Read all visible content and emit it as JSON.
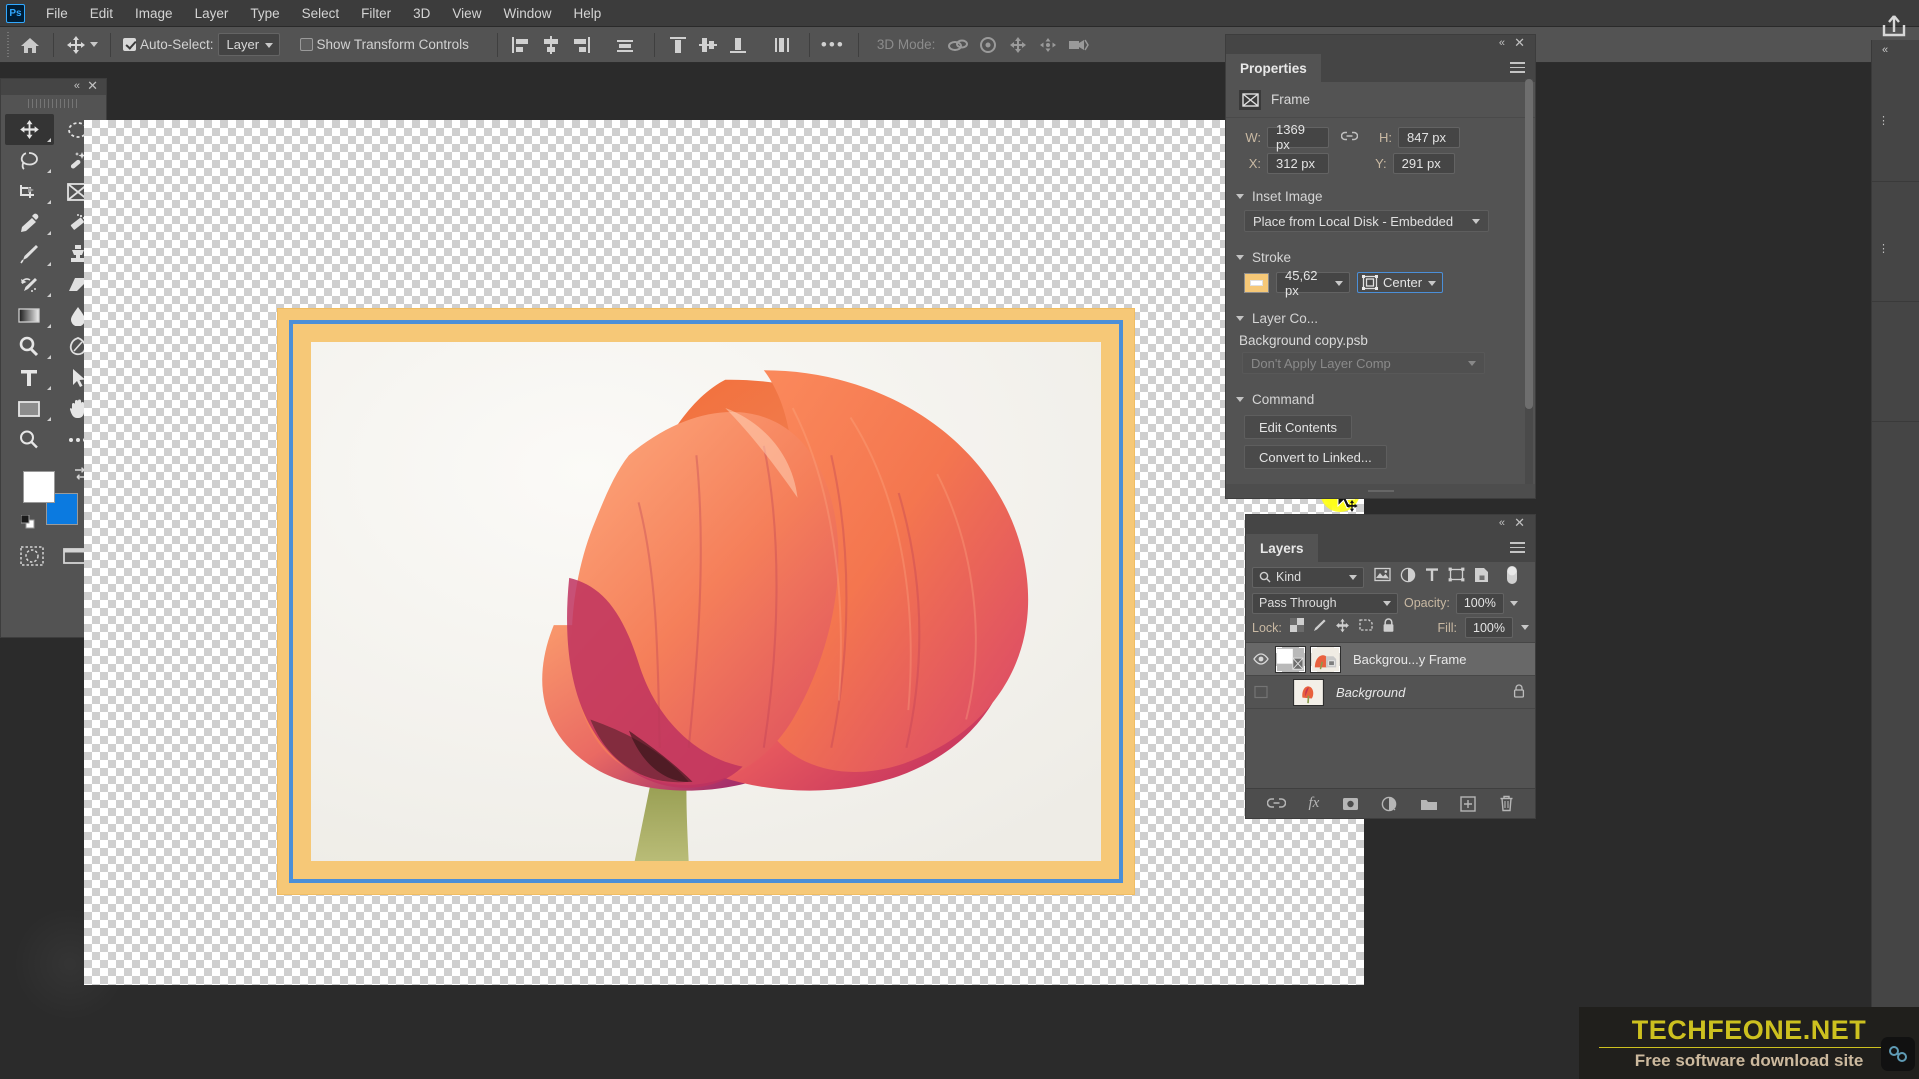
{
  "app": {
    "name": "Adobe Photoshop",
    "logo_text": "Ps"
  },
  "menubar": {
    "items": [
      "File",
      "Edit",
      "Image",
      "Layer",
      "Type",
      "Select",
      "Filter",
      "3D",
      "View",
      "Window",
      "Help"
    ]
  },
  "options_bar": {
    "home_icon": "home-icon",
    "tool_icon": "move-tool-icon",
    "auto_select_label": "Auto-Select:",
    "auto_select_checked": true,
    "auto_select_value": "Layer",
    "show_transform_label": "Show Transform Controls",
    "show_transform_checked": false,
    "align_left_icon": "align-left-edges-icon",
    "align_hcenter_icon": "align-horizontal-centers-icon",
    "align_right_icon": "align-right-edges-icon",
    "distribute_icon": "distribute-icon",
    "align_top_icon": "align-top-edges-icon",
    "align_vcenter_icon": "align-vertical-centers-icon",
    "align_bottom_icon": "align-bottom-edges-icon",
    "distribute_v_icon": "distribute-vertical-icon",
    "more_label": "•••",
    "mode_3d_label": "3D Mode:",
    "mode_3d_icons": [
      "rotate-3d-icon",
      "roll-3d-icon",
      "drag-3d-icon",
      "slide-3d-icon",
      "camera-3d-icon"
    ]
  },
  "toolbar": {
    "collapse_icon": "collapse-panel-icon",
    "close_icon": "close-icon",
    "tools": [
      {
        "name": "move-tool",
        "active": true,
        "has_flyout": true
      },
      {
        "name": "elliptical-marquee-tool",
        "active": false,
        "has_flyout": true
      },
      {
        "name": "lasso-tool",
        "active": false,
        "has_flyout": true
      },
      {
        "name": "magic-wand-tool",
        "active": false,
        "has_flyout": true
      },
      {
        "name": "crop-tool",
        "active": false,
        "has_flyout": true
      },
      {
        "name": "frame-tool",
        "active": false,
        "has_flyout": false
      },
      {
        "name": "eyedropper-tool",
        "active": false,
        "has_flyout": true
      },
      {
        "name": "spot-healing-brush-tool",
        "active": false,
        "has_flyout": true
      },
      {
        "name": "brush-tool",
        "active": false,
        "has_flyout": true
      },
      {
        "name": "clone-stamp-tool",
        "active": false,
        "has_flyout": true
      },
      {
        "name": "history-brush-tool",
        "active": false,
        "has_flyout": true
      },
      {
        "name": "eraser-tool",
        "active": false,
        "has_flyout": true
      },
      {
        "name": "gradient-tool",
        "active": false,
        "has_flyout": true
      },
      {
        "name": "blur-tool",
        "active": false,
        "has_flyout": true
      },
      {
        "name": "dodge-tool",
        "active": false,
        "has_flyout": true
      },
      {
        "name": "pen-tool",
        "active": false,
        "has_flyout": true
      },
      {
        "name": "type-tool",
        "active": false,
        "has_flyout": true
      },
      {
        "name": "path-selection-tool",
        "active": false,
        "has_flyout": true
      },
      {
        "name": "rectangle-tool",
        "active": false,
        "has_flyout": true
      },
      {
        "name": "hand-tool",
        "active": false,
        "has_flyout": true
      },
      {
        "name": "zoom-tool",
        "active": false,
        "has_flyout": false
      },
      {
        "name": "edit-toolbar-more-tools",
        "active": false,
        "has_flyout": true
      }
    ],
    "foreground_color": "#ffffff",
    "background_color": "#0b7ae0",
    "swap_colors_icon": "swap-colors-icon",
    "default_colors_icon": "default-colors-icon",
    "quick_mask_icon": "quick-mask-mode-icon",
    "screen_mode_icon": "screen-mode-icon"
  },
  "properties": {
    "panel_title": "Properties",
    "collapse_icon": "collapse-panel-icon",
    "close_icon": "close-icon",
    "menu_icon": "panel-menu-icon",
    "object_type_icon": "frame-icon",
    "object_type": "Frame",
    "w_label": "W:",
    "w_value": "1369 px",
    "link_icon": "link-dimensions-icon",
    "h_label": "H:",
    "h_value": "847 px",
    "x_label": "X:",
    "x_value": "312 px",
    "y_label": "Y:",
    "y_value": "291 px",
    "inset_image_section": "Inset Image",
    "inset_image_value": "Place from Local Disk - Embedded",
    "stroke_section": "Stroke",
    "stroke_color": "#f6c877",
    "stroke_width": "45,62 px",
    "stroke_align_icon": "stroke-align-icon",
    "stroke_align": "Center",
    "layer_comp_section": "Layer Co...",
    "layer_comp_file": "Background copy.psb",
    "layer_comp_value": "Don't Apply Layer Comp",
    "command_section": "Command",
    "edit_contents_label": "Edit Contents",
    "convert_to_linked_label": "Convert to Linked..."
  },
  "layers": {
    "panel_title": "Layers",
    "collapse_icon": "collapse-panel-icon",
    "close_icon": "close-icon",
    "menu_icon": "panel-menu-icon",
    "filter_icon": "search-icon",
    "filter_kind": "Kind",
    "filter_type_icons": [
      "pixel-layer-filter-icon",
      "adjustment-layer-filter-icon",
      "type-layer-filter-icon",
      "shape-layer-filter-icon",
      "smart-object-filter-icon"
    ],
    "filter_toggle_icon": "filter-toggle-icon",
    "blend_mode": "Pass Through",
    "opacity_label": "Opacity:",
    "opacity_value": "100%",
    "lock_label": "Lock:",
    "lock_icons": [
      "lock-transparent-pixels-icon",
      "lock-image-pixels-icon",
      "lock-position-icon",
      "lock-artboard-nesting-icon",
      "lock-all-icon"
    ],
    "fill_label": "Fill:",
    "fill_value": "100%",
    "rows": [
      {
        "name": "Backgrou...y Frame",
        "visible": true,
        "selected": true,
        "locked": false,
        "italic": false,
        "eye_icon": "eye-visible-icon",
        "thumb_icon": "frame-thumbnail",
        "second_thumb_icon": "smart-object-thumbnail"
      },
      {
        "name": "Background",
        "visible": false,
        "selected": false,
        "locked": true,
        "italic": true,
        "eye_icon": "eye-hidden-icon",
        "thumb_icon": "tulip-thumbnail",
        "lock_icon": "lock-icon"
      }
    ],
    "footer_icons": [
      {
        "name": "link-layers-icon",
        "glyph": "⚭"
      },
      {
        "name": "layer-style-fx-icon",
        "glyph": "fx"
      },
      {
        "name": "add-layer-mask-icon",
        "glyph": "▣"
      },
      {
        "name": "new-fill-adjustment-layer-icon",
        "glyph": "◑"
      },
      {
        "name": "new-group-icon",
        "glyph": "▰"
      },
      {
        "name": "new-layer-icon",
        "glyph": "⊞"
      },
      {
        "name": "delete-layer-icon",
        "glyph": "Ὕ1"
      }
    ]
  },
  "share": {
    "icon": "share-export-icon"
  },
  "canvas": {
    "frame_stroke_color": "#f6c877",
    "selection_color": "#4b8fd8",
    "photo_description": "orange-pink tulip close-up on white background",
    "cursor_icon": "move-cursor-with-highlight"
  },
  "watermark": {
    "title": "TECHFEONE.NET",
    "subtitle": "Free software download site",
    "badge_icon": "link-chain-icon",
    "title_color": "#cdc11f",
    "subtitle_color": "#ccb99e"
  }
}
